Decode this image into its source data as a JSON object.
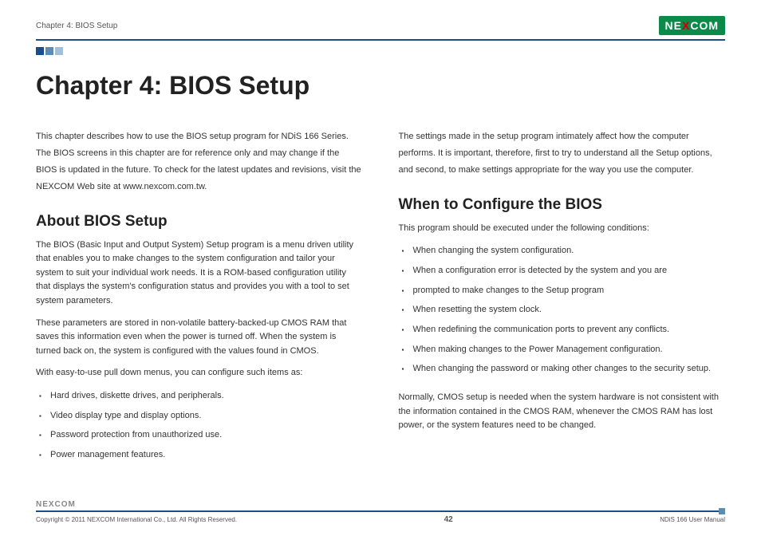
{
  "header": {
    "chapter_label": "Chapter 4: BIOS Setup",
    "logo_text_pre": "NE",
    "logo_text_x": "X",
    "logo_text_post": "COM"
  },
  "title": "Chapter 4: BIOS Setup",
  "col1": {
    "intro": "This chapter describes how to use the BIOS setup program for NDiS 166 Series. The BIOS screens in this chapter are for reference only and may change if the BIOS is updated in the future. To check for the latest updates and revisions, visit the NEXCOM Web site at www.nexcom.com.tw.",
    "section_title": "About BIOS Setup",
    "p1": "The BIOS (Basic Input and Output System) Setup program is a menu driven utility that enables you to make changes to the system configuration and tailor your system to suit your individual work needs. It is a ROM-based configuration utility that displays the system's configuration status and provides you with a tool to set system parameters.",
    "p2": "These parameters are stored in non-volatile battery-backed-up CMOS RAM that saves this information even when the power is turned off. When the system is turned back on, the system is configured with the values found in CMOS.",
    "p3": "With easy-to-use pull down menus, you can configure such items as:",
    "bullets": [
      "Hard drives, diskette drives, and peripherals.",
      "Video display type and display options.",
      "Password protection from unauthorized use.",
      "Power management features."
    ]
  },
  "col2": {
    "intro": "The settings made in the setup program intimately affect how the computer performs. It is important, therefore, first to try to understand all the Setup options, and second, to make settings appropriate for the way you use the computer.",
    "section_title": "When to Configure the BIOS",
    "p1": "This program should be executed under the following conditions:",
    "bullets": [
      "When changing the system configuration.",
      "When a configuration error is detected by the system and you are",
      "prompted to make changes to the Setup program",
      "When resetting the system clock.",
      "When redefining the communication ports to prevent any conflicts.",
      "When making changes to the Power Management configuration.",
      "When changing the password or making other changes to the security setup."
    ],
    "p2": "Normally, CMOS setup is needed when the system hardware is not consistent with the information contained in the CMOS RAM, whenever the CMOS RAM has lost power, or the system features need to be changed."
  },
  "footer": {
    "logo": "NEXCOM",
    "copyright": "Copyright © 2011 NEXCOM International Co., Ltd. All Rights Reserved.",
    "page": "42",
    "manual": "NDiS 166 User Manual"
  }
}
